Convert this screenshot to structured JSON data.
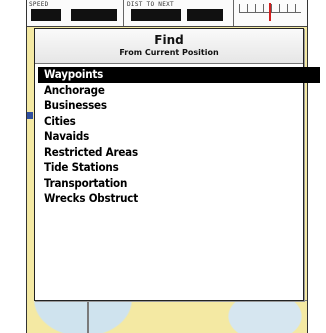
{
  "topbar": {
    "speed_label": "SPEED",
    "dist_label": "DIST TO NEXT"
  },
  "find_dialog": {
    "title": "Find",
    "subtitle": "From Current Position",
    "items": [
      {
        "label": "Waypoints",
        "selected": true
      },
      {
        "label": "Anchorage",
        "selected": false
      },
      {
        "label": "Businesses",
        "selected": false
      },
      {
        "label": "Cities",
        "selected": false
      },
      {
        "label": "Navaids",
        "selected": false
      },
      {
        "label": "Restricted Areas",
        "selected": false
      },
      {
        "label": "Tide Stations",
        "selected": false
      },
      {
        "label": "Transportation",
        "selected": false
      },
      {
        "label": "Wrecks Obstruct",
        "selected": false
      }
    ]
  },
  "colors": {
    "map_land": "#f4e9a3",
    "selection": "#000000",
    "scale_marker": "#d21e1e"
  }
}
